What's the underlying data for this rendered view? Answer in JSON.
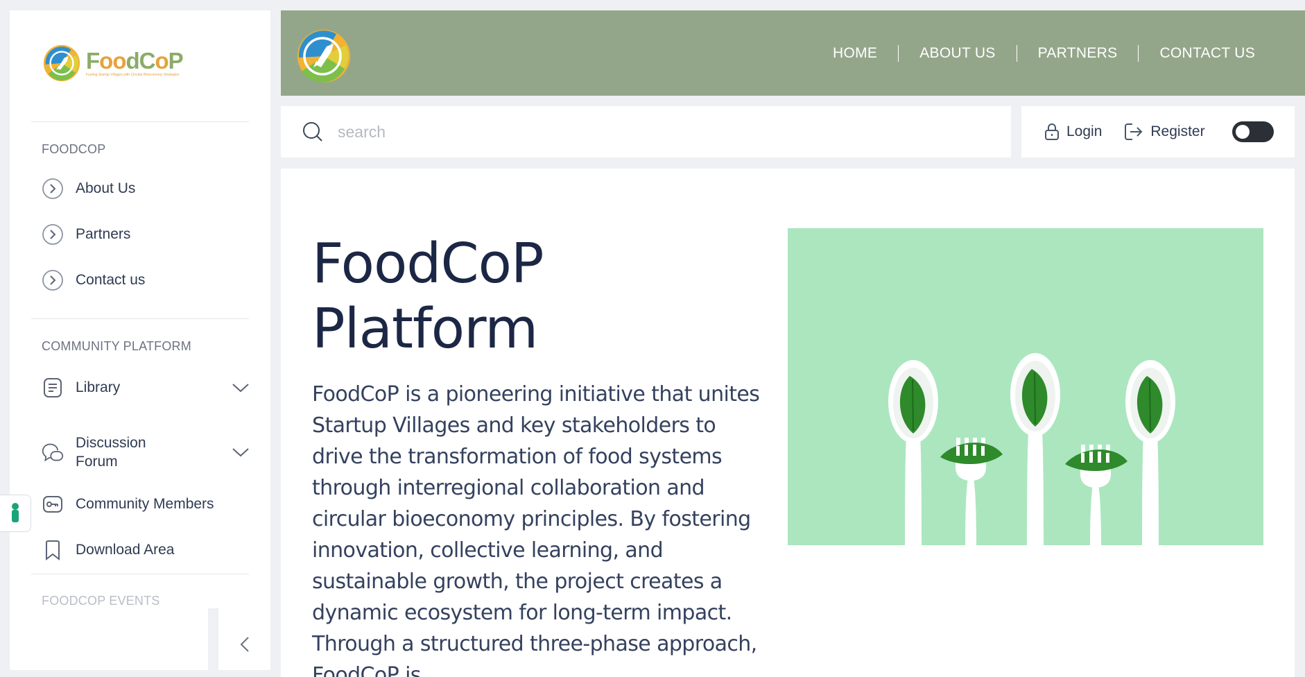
{
  "brand": {
    "name_part1": "F",
    "name_o": "oo",
    "name_part2": "dC",
    "name_o2": "o",
    "name_part3": "P",
    "tagline": "Fueling Startup Villages with Circular Bioeconomy Strategies"
  },
  "sidebar": {
    "sections": [
      {
        "title": "FOODCOP",
        "items": [
          {
            "label": "About Us",
            "icon": "chevron-circle-icon"
          },
          {
            "label": "Partners",
            "icon": "chevron-circle-icon"
          },
          {
            "label": "Contact us",
            "icon": "chevron-circle-icon"
          }
        ]
      },
      {
        "title": "COMMUNITY PLATFORM",
        "items": [
          {
            "label": "Library",
            "icon": "document-icon",
            "expandable": true
          },
          {
            "label": "Discussion Forum",
            "label_line1": "Discussion",
            "label_line2": "Forum",
            "icon": "chat-icon",
            "expandable": true
          },
          {
            "label": "Community Members",
            "icon": "key-icon"
          },
          {
            "label": "Download Area",
            "icon": "bookmark-icon"
          }
        ]
      },
      {
        "title": "FOODCOP EVENTS",
        "items": []
      }
    ]
  },
  "topnav": {
    "items": [
      "HOME",
      "ABOUT US",
      "PARTNERS",
      "CONTACT US"
    ]
  },
  "search": {
    "placeholder": "search",
    "value": ""
  },
  "auth": {
    "login_label": "Login",
    "register_label": "Register",
    "theme_toggle": "off"
  },
  "hero": {
    "title_line1": "FoodCoP",
    "title_line2": "Platform",
    "description": "FoodCoP is a pioneering initiative that unites Startup Villages and key stakeholders to drive the transformation of food systems through interregional collaboration and circular bioeconomy principles. By fostering innovation, collective learning, and sustainable growth, the project creates a dynamic ecosystem for long-term impact. Through a structured three-phase approach, FoodCoP is"
  },
  "colors": {
    "header_bg": "#94a68a",
    "brand_green": "#8bab6a",
    "brand_orange": "#e6a23a",
    "hero_img_bg": "#abe6bf",
    "title_text": "#1c2745"
  }
}
